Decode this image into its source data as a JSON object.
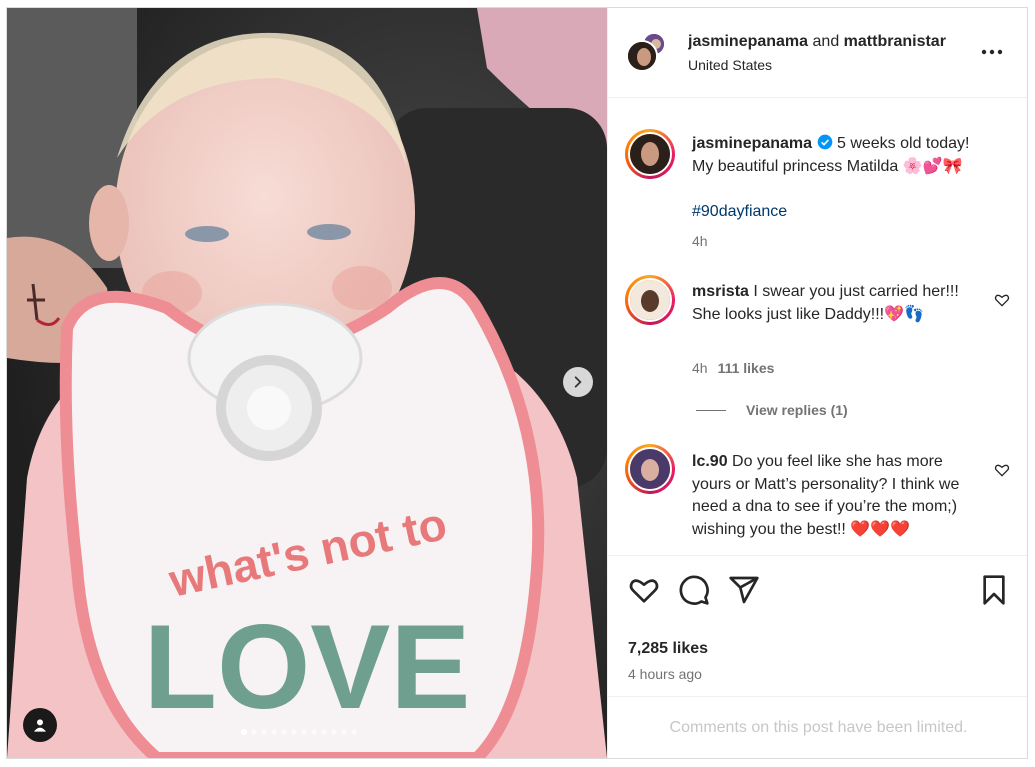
{
  "header": {
    "owner": "jasminepanama",
    "joiner": "and",
    "collaborator": "mattbranistar",
    "location": "United States"
  },
  "caption": {
    "username": "jasminepanama",
    "text": "5 weeks old today! My beautiful princess Matilda 🌸💕🎀",
    "hashtag": "#90dayfiance",
    "time": "4h"
  },
  "comments": [
    {
      "username": "msrista",
      "text": "I swear you just carried her!!! She looks just like Daddy!!!💖👣",
      "time": "4h",
      "likes": "111 likes",
      "view_replies": "View replies (1)"
    },
    {
      "username": "lc.90",
      "text": "Do you feel like she has more yours or Matt’s personality? I think we need a dna to see if you’re the mom;) wishing you the best!! ❤️❤️❤️"
    }
  ],
  "post": {
    "likes": "7,285 likes",
    "time_ago": "4 hours ago",
    "comments_limited": "Comments on this post have been limited."
  },
  "media": {
    "bib_text": "what's not to",
    "bib_love": "LOVE",
    "carousel_total": 12,
    "carousel_active": 1
  },
  "icons": {
    "more": "more-options-icon",
    "like": "heart-icon",
    "comment": "comment-icon",
    "share": "share-icon",
    "save": "bookmark-icon",
    "next": "chevron-right-icon",
    "tags": "user-tag-icon"
  },
  "colors": {
    "verified": "#0095f6",
    "hashtag": "#00376b",
    "muted": "#737373",
    "limited_text": "#c7c7c7"
  }
}
